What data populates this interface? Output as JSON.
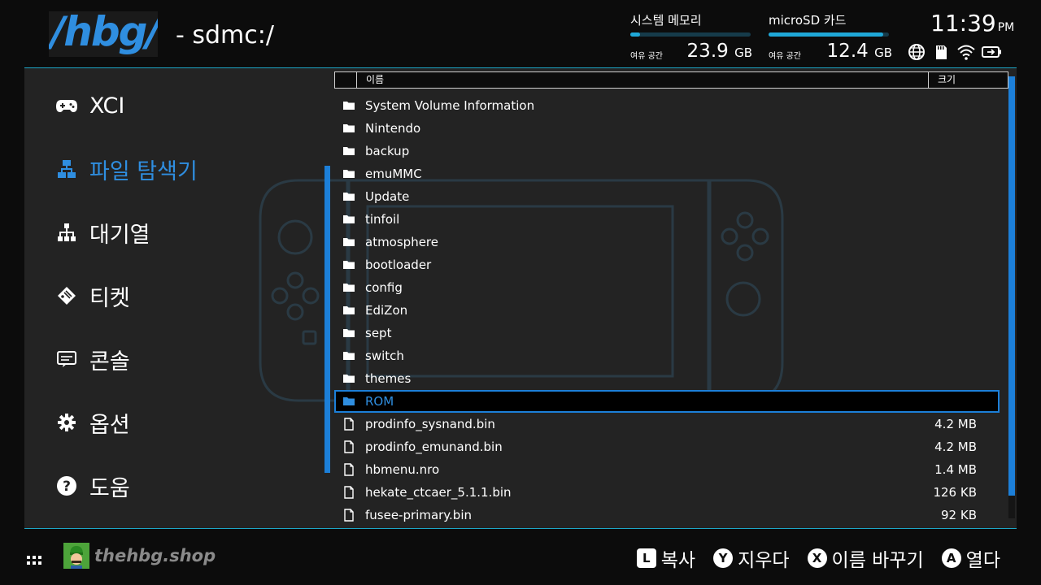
{
  "header": {
    "logo_text": "/hbg/",
    "path": "- sdmc:/",
    "system_memory": {
      "label": "시스템 메모리",
      "free_label": "여유 공간",
      "value": "23.9",
      "unit": "GB",
      "used_fraction": 0.08
    },
    "sd_card": {
      "label": "microSD 카드",
      "free_label": "여유 공간",
      "value": "12.4",
      "unit": "GB",
      "used_fraction": 0.95
    },
    "clock": {
      "time": "11:39",
      "ampm": "PM"
    },
    "status_icons": [
      "globe-icon",
      "sd-card-icon",
      "wifi-icon",
      "battery-charging-icon"
    ]
  },
  "sidebar": {
    "items": [
      {
        "label": "XCI",
        "icon": "gamepad-icon",
        "active": false
      },
      {
        "label": "파일 탐색기",
        "icon": "file-tree-icon",
        "active": true
      },
      {
        "label": "대기열",
        "icon": "queue-icon",
        "active": false
      },
      {
        "label": "티켓",
        "icon": "ticket-icon",
        "active": false
      },
      {
        "label": "콘솔",
        "icon": "console-icon",
        "active": false
      },
      {
        "label": "옵션",
        "icon": "gear-icon",
        "active": false
      },
      {
        "label": "도움",
        "icon": "help-icon",
        "active": false
      }
    ]
  },
  "table": {
    "col_name": "이름",
    "col_size": "크기"
  },
  "files": [
    {
      "name": "System Volume Information",
      "type": "folder",
      "size": ""
    },
    {
      "name": "Nintendo",
      "type": "folder",
      "size": ""
    },
    {
      "name": "backup",
      "type": "folder",
      "size": ""
    },
    {
      "name": "emuMMC",
      "type": "folder",
      "size": ""
    },
    {
      "name": "Update",
      "type": "folder",
      "size": ""
    },
    {
      "name": "tinfoil",
      "type": "folder",
      "size": ""
    },
    {
      "name": "atmosphere",
      "type": "folder",
      "size": ""
    },
    {
      "name": "bootloader",
      "type": "folder",
      "size": ""
    },
    {
      "name": "config",
      "type": "folder",
      "size": ""
    },
    {
      "name": "EdiZon",
      "type": "folder",
      "size": ""
    },
    {
      "name": "sept",
      "type": "folder",
      "size": ""
    },
    {
      "name": "switch",
      "type": "folder",
      "size": ""
    },
    {
      "name": "themes",
      "type": "folder",
      "size": ""
    },
    {
      "name": "ROM",
      "type": "folder",
      "size": "",
      "selected": true
    },
    {
      "name": "prodinfo_sysnand.bin",
      "type": "file",
      "size": "4.2 MB"
    },
    {
      "name": "prodinfo_emunand.bin",
      "type": "file",
      "size": "4.2 MB"
    },
    {
      "name": "hbmenu.nro",
      "type": "file",
      "size": "1.4 MB"
    },
    {
      "name": "hekate_ctcaer_5.1.1.bin",
      "type": "file",
      "size": "126 KB"
    },
    {
      "name": "fusee-primary.bin",
      "type": "file",
      "size": "92 KB"
    }
  ],
  "footer": {
    "site": "thehbg.shop",
    "hints": [
      {
        "button": "L",
        "label": "복사",
        "shape": "square"
      },
      {
        "button": "Y",
        "label": "지우다",
        "shape": "circle"
      },
      {
        "button": "X",
        "label": "이름 바꾸기",
        "shape": "circle"
      },
      {
        "button": "A",
        "label": "열다",
        "shape": "circle"
      }
    ]
  },
  "colors": {
    "accent": "#2f8ee0",
    "selection_border": "#1c7fd8",
    "divider": "#1da6c6",
    "panel": "#232323",
    "background": "#0c0c0c"
  }
}
